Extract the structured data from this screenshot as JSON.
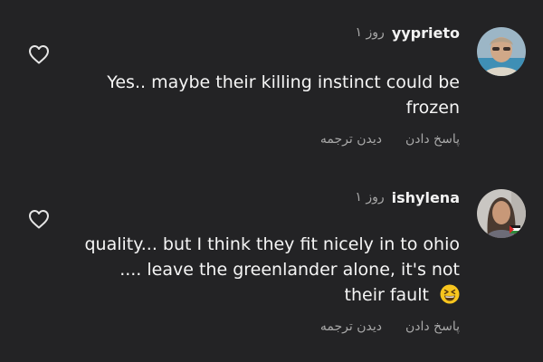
{
  "comments": [
    {
      "username": "yyprieto",
      "time": "۱ روز",
      "text": "Yes.. maybe their killing instinct could be frozen",
      "actions": {
        "reply": "پاسخ دادن",
        "translate": "دیدن ترجمه"
      }
    },
    {
      "username": "ishylena",
      "time": "۱ روز",
      "text": "quality... but I think they fit nicely in to ohio .... leave the greenlander alone, it's not their fault",
      "emoji": "grinning-squinting-face",
      "actions": {
        "reply": "پاسخ دادن",
        "translate": "دیدن ترجمه"
      }
    }
  ],
  "colors": {
    "background": "#232325",
    "text_primary": "#f5f5f5",
    "text_secondary": "#a8a8a8",
    "emoji": "#f7c51e"
  },
  "icons": [
    "heart-icon",
    "emoji-icon"
  ]
}
